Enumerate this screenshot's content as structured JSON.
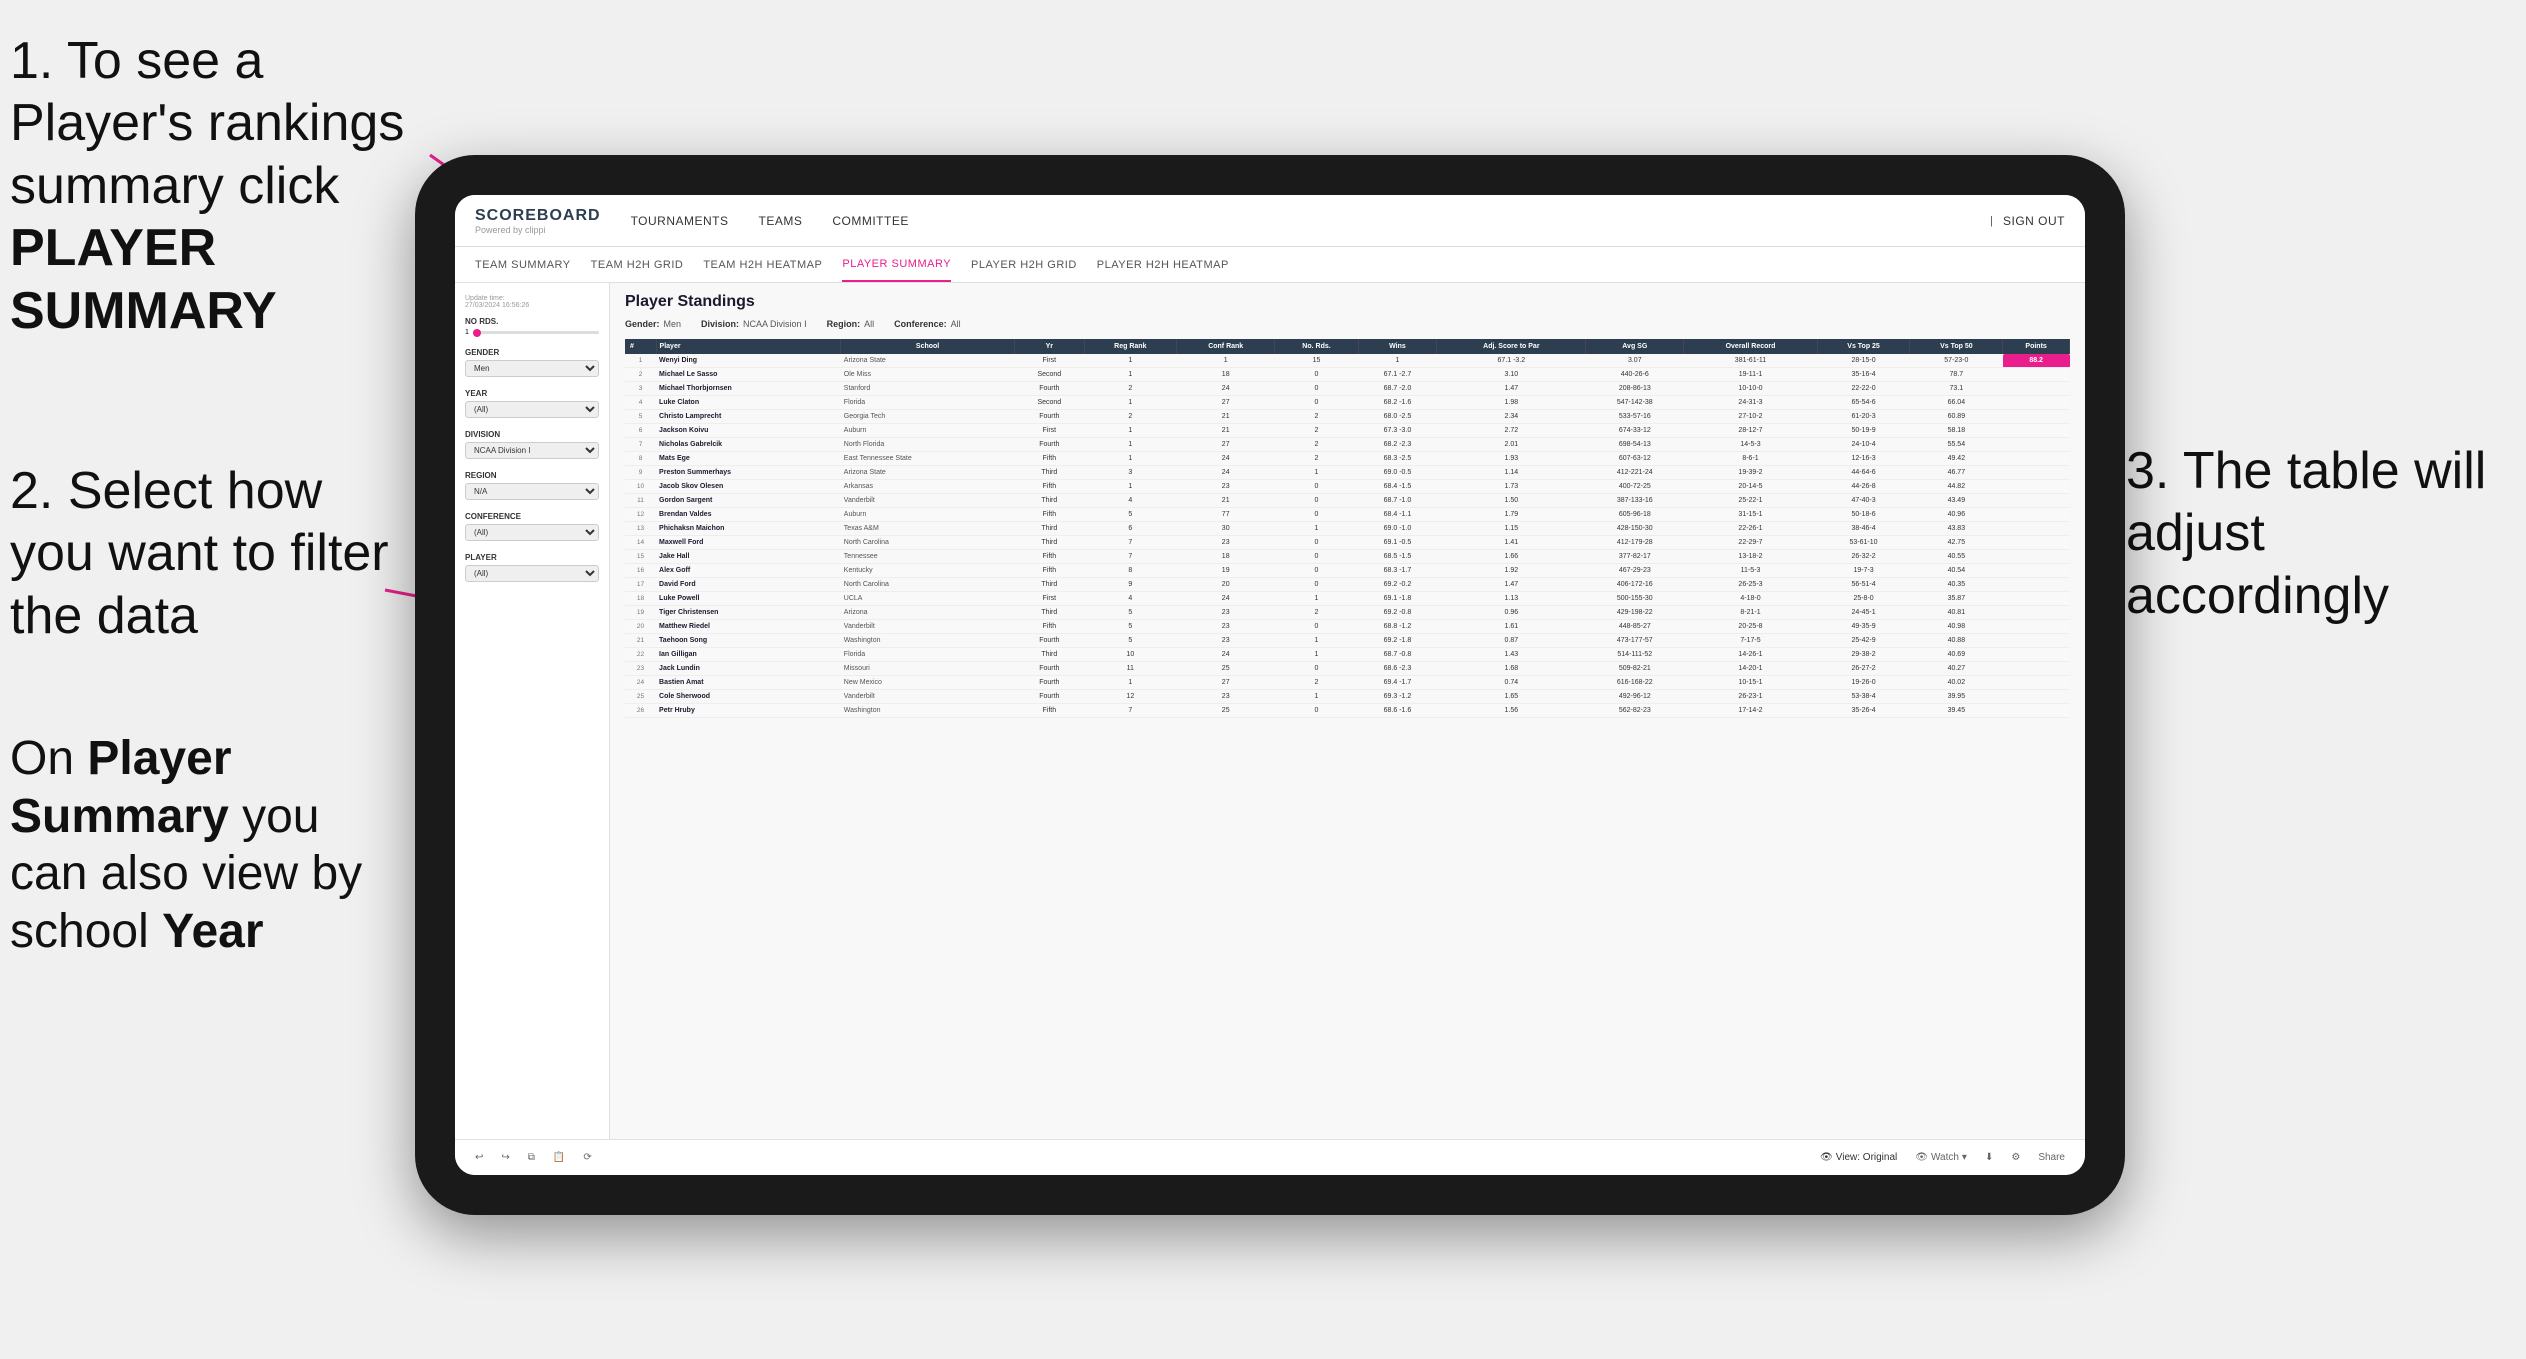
{
  "annotations": {
    "step1": "1. To see a Player's rankings summary click ",
    "step1_bold": "PLAYER SUMMARY",
    "step2_title": "2. Select how you want to filter the data",
    "step3_title": "3. The table will adjust accordingly",
    "bottom_note_prefix": "On ",
    "bottom_note_bold1": "Player Summary",
    "bottom_note_mid": " you can also view by school ",
    "bottom_note_bold2": "Year"
  },
  "nav": {
    "logo": "SCOREBOARD",
    "logo_sub": "Powered by clippi",
    "items": [
      "TOURNAMENTS",
      "TEAMS",
      "COMMITTEE"
    ],
    "sign_out": "Sign out"
  },
  "sub_nav": {
    "items": [
      "TEAM SUMMARY",
      "TEAM H2H GRID",
      "TEAM H2H HEATMAP",
      "PLAYER SUMMARY",
      "PLAYER H2H GRID",
      "PLAYER H2H HEATMAP"
    ],
    "active": "PLAYER SUMMARY"
  },
  "sidebar": {
    "update_label": "Update time:",
    "update_time": "27/03/2024 16:56:26",
    "no_rds_label": "No Rds.",
    "gender_label": "Gender",
    "gender_value": "Men",
    "year_label": "Year",
    "year_value": "(All)",
    "division_label": "Division",
    "division_value": "NCAA Division I",
    "region_label": "Region",
    "region_value": "N/A",
    "conference_label": "Conference",
    "conference_value": "(All)",
    "player_label": "Player",
    "player_value": "(All)"
  },
  "table": {
    "title": "Player Standings",
    "filters": {
      "gender_label": "Gender:",
      "gender_value": "Men",
      "division_label": "Division:",
      "division_value": "NCAA Division I",
      "region_label": "Region:",
      "region_value": "All",
      "conference_label": "Conference:",
      "conference_value": "All"
    },
    "headers": [
      "#",
      "Player",
      "School",
      "Yr",
      "Reg Rank",
      "Conf Rank",
      "No. Rds.",
      "Wins",
      "Adj. Score to Par",
      "Avg SG",
      "Overall Record",
      "Vs Top 25",
      "Vs Top 50",
      "Points"
    ],
    "rows": [
      [
        1,
        "Wenyi Ding",
        "Arizona State",
        "First",
        1,
        1,
        15,
        1,
        "67.1 -3.2",
        "3.07",
        "381-61-11",
        "28-15-0",
        "57-23-0",
        "88.2"
      ],
      [
        2,
        "Michael Le Sasso",
        "Ole Miss",
        "Second",
        1,
        18,
        0,
        "67.1 -2.7",
        "3.10",
        "440-26-6",
        "19-11-1",
        "35-16-4",
        "78.7"
      ],
      [
        3,
        "Michael Thorbjornsen",
        "Stanford",
        "Fourth",
        2,
        24,
        0,
        "68.7 -2.0",
        "1.47",
        "208-86-13",
        "10-10-0",
        "22-22-0",
        "73.1"
      ],
      [
        4,
        "Luke Claton",
        "Florida",
        "Second",
        1,
        27,
        0,
        "68.2 -1.6",
        "1.98",
        "547-142-38",
        "24-31-3",
        "65-54-6",
        "66.04"
      ],
      [
        5,
        "Christo Lamprecht",
        "Georgia Tech",
        "Fourth",
        2,
        21,
        2,
        "68.0 -2.5",
        "2.34",
        "533-57-16",
        "27-10-2",
        "61-20-3",
        "60.89"
      ],
      [
        6,
        "Jackson Koivu",
        "Auburn",
        "First",
        1,
        21,
        2,
        "67.3 -3.0",
        "2.72",
        "674-33-12",
        "28-12-7",
        "50-19-9",
        "58.18"
      ],
      [
        7,
        "Nicholas Gabrelcik",
        "North Florida",
        "Fourth",
        1,
        27,
        2,
        "68.2 -2.3",
        "2.01",
        "698-54-13",
        "14-5-3",
        "24-10-4",
        "55.54"
      ],
      [
        8,
        "Mats Ege",
        "East Tennessee State",
        "Fifth",
        1,
        24,
        2,
        "68.3 -2.5",
        "1.93",
        "607-63-12",
        "8-6-1",
        "12-16-3",
        "49.42"
      ],
      [
        9,
        "Preston Summerhays",
        "Arizona State",
        "Third",
        3,
        24,
        1,
        "69.0 -0.5",
        "1.14",
        "412-221-24",
        "19-39-2",
        "44-64-6",
        "46.77"
      ],
      [
        10,
        "Jacob Skov Olesen",
        "Arkansas",
        "Fifth",
        1,
        23,
        0,
        "68.4 -1.5",
        "1.73",
        "400-72-25",
        "20-14-5",
        "44-26-8",
        "44.82"
      ],
      [
        11,
        "Gordon Sargent",
        "Vanderbilt",
        "Third",
        4,
        21,
        0,
        "68.7 -1.0",
        "1.50",
        "387-133-16",
        "25-22-1",
        "47-40-3",
        "43.49"
      ],
      [
        12,
        "Brendan Valdes",
        "Auburn",
        "Fifth",
        5,
        77,
        0,
        "68.4 -1.1",
        "1.79",
        "605-96-18",
        "31-15-1",
        "50-18-6",
        "40.96"
      ],
      [
        13,
        "Phichaksn Maichon",
        "Texas A&M",
        "Third",
        6,
        30,
        1,
        "69.0 -1.0",
        "1.15",
        "428-150-30",
        "22-26-1",
        "38-46-4",
        "43.83"
      ],
      [
        14,
        "Maxwell Ford",
        "North Carolina",
        "Third",
        7,
        23,
        0,
        "69.1 -0.5",
        "1.41",
        "412-179-28",
        "22-29-7",
        "53-61-10",
        "42.75"
      ],
      [
        15,
        "Jake Hall",
        "Tennessee",
        "Fifth",
        7,
        18,
        0,
        "68.5 -1.5",
        "1.66",
        "377-82-17",
        "13-18-2",
        "26-32-2",
        "40.55"
      ],
      [
        16,
        "Alex Goff",
        "Kentucky",
        "Fifth",
        8,
        19,
        0,
        "68.3 -1.7",
        "1.92",
        "467-29-23",
        "11-5-3",
        "19-7-3",
        "40.54"
      ],
      [
        17,
        "David Ford",
        "North Carolina",
        "Third",
        9,
        20,
        0,
        "69.2 -0.2",
        "1.47",
        "406-172-16",
        "26-25-3",
        "56-51-4",
        "40.35"
      ],
      [
        18,
        "Luke Powell",
        "UCLA",
        "First",
        4,
        24,
        1,
        "69.1 -1.8",
        "1.13",
        "500-155-30",
        "4-18-0",
        "25-8-0",
        "35.87"
      ],
      [
        19,
        "Tiger Christensen",
        "Arizona",
        "Third",
        5,
        23,
        2,
        "69.2 -0.8",
        "0.96",
        "429-198-22",
        "8-21-1",
        "24-45-1",
        "40.81"
      ],
      [
        20,
        "Matthew Riedel",
        "Vanderbilt",
        "Fifth",
        5,
        23,
        0,
        "68.8 -1.2",
        "1.61",
        "448-85-27",
        "20-25-8",
        "49-35-9",
        "40.98"
      ],
      [
        21,
        "Taehoon Song",
        "Washington",
        "Fourth",
        5,
        23,
        1,
        "69.2 -1.8",
        "0.87",
        "473-177-57",
        "7-17-5",
        "25-42-9",
        "40.88"
      ],
      [
        22,
        "Ian Gilligan",
        "Florida",
        "Third",
        10,
        24,
        1,
        "68.7 -0.8",
        "1.43",
        "514-111-52",
        "14-26-1",
        "29-38-2",
        "40.69"
      ],
      [
        23,
        "Jack Lundin",
        "Missouri",
        "Fourth",
        11,
        25,
        0,
        "68.6 -2.3",
        "1.68",
        "509-82-21",
        "14-20-1",
        "26-27-2",
        "40.27"
      ],
      [
        24,
        "Bastien Amat",
        "New Mexico",
        "Fourth",
        1,
        27,
        2,
        "69.4 -1.7",
        "0.74",
        "616-168-22",
        "10-15-1",
        "19-26-0",
        "40.02"
      ],
      [
        25,
        "Cole Sherwood",
        "Vanderbilt",
        "Fourth",
        12,
        23,
        1,
        "69.3 -1.2",
        "1.65",
        "492-96-12",
        "26-23-1",
        "53-38-4",
        "39.95"
      ],
      [
        26,
        "Petr Hruby",
        "Washington",
        "Fifth",
        7,
        25,
        0,
        "68.6 -1.6",
        "1.56",
        "562-82-23",
        "17-14-2",
        "35-26-4",
        "39.45"
      ]
    ]
  },
  "toolbar": {
    "view_label": "View: Original",
    "watch_label": "Watch",
    "share_label": "Share"
  }
}
